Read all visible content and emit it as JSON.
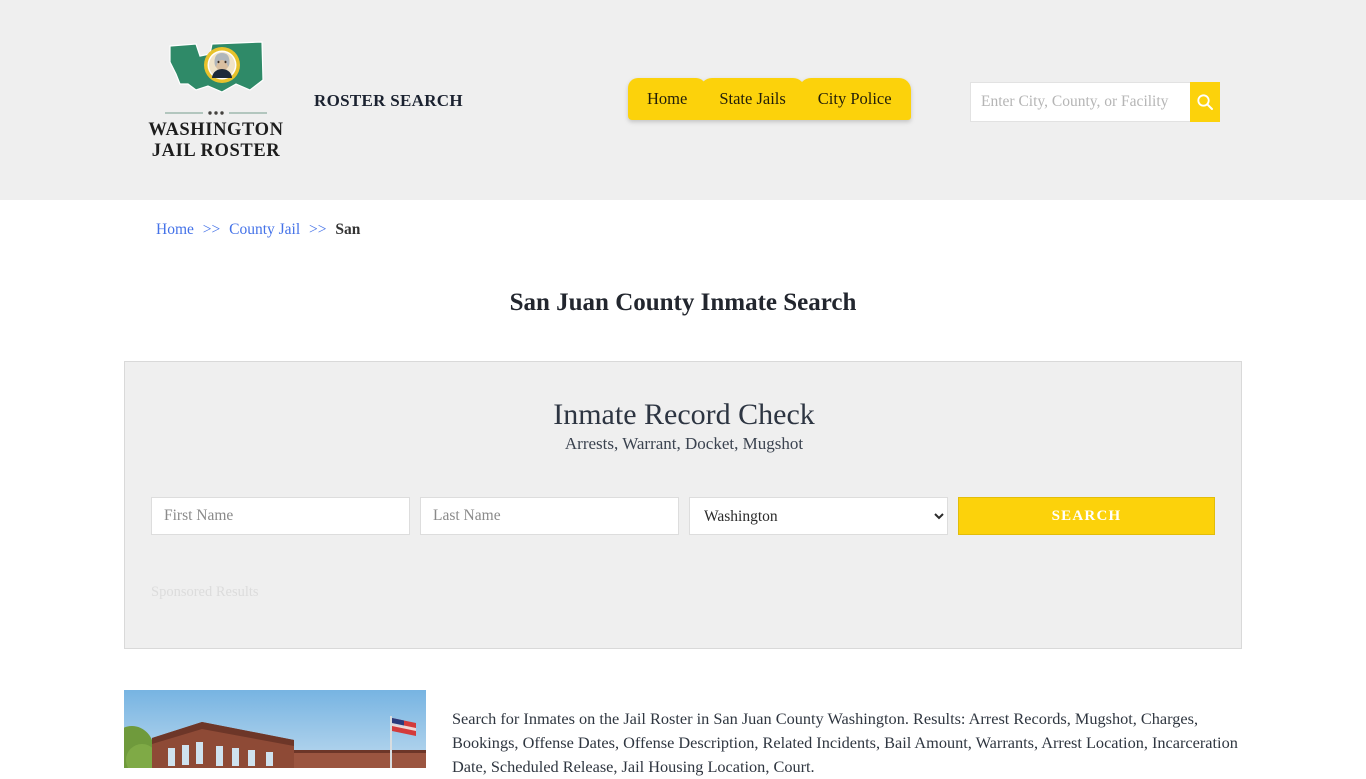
{
  "header": {
    "logo": {
      "icon": "washington-state-flag-icon",
      "line1": "WASHINGTON",
      "line2": "JAIL ROSTER"
    },
    "tagline": "ROSTER SEARCH",
    "nav": [
      {
        "label": "Home"
      },
      {
        "label": "State Jails"
      },
      {
        "label": "City Police"
      }
    ],
    "search": {
      "placeholder": "Enter City, County, or Facility",
      "value": "",
      "button_icon": "search-icon"
    }
  },
  "breadcrumb": {
    "items": [
      {
        "label": "Home",
        "link": true
      },
      {
        "label": "County Jail",
        "link": true
      },
      {
        "label": "San",
        "link": false
      }
    ],
    "separator": ">>"
  },
  "page": {
    "title": "San Juan County Inmate Search"
  },
  "card": {
    "title": "Inmate Record Check",
    "subtitle": "Arrests, Warrant, Docket, Mugshot",
    "form": {
      "first_name_placeholder": "First Name",
      "first_name_value": "",
      "last_name_placeholder": "Last Name",
      "last_name_value": "",
      "state_selected": "Washington",
      "state_options": [
        "Washington"
      ],
      "submit_label": "SEARCH"
    },
    "sponsored_label": "Sponsored Results"
  },
  "content": {
    "photo_alt": "county-courthouse-photo",
    "description": "Search for Inmates on the Jail Roster in San Juan County Washington. Results: Arrest Records, Mugshot, Charges, Bookings, Offense Dates, Offense Description, Related Incidents, Bail Amount, Warrants, Arrest Location, Incarceration Date, Scheduled Release, Jail Housing Location, Court."
  },
  "colors": {
    "accent_yellow": "#fcd20b",
    "header_bg": "#efefef",
    "link_blue": "#4472e8",
    "logo_green": "#2f8a68"
  }
}
